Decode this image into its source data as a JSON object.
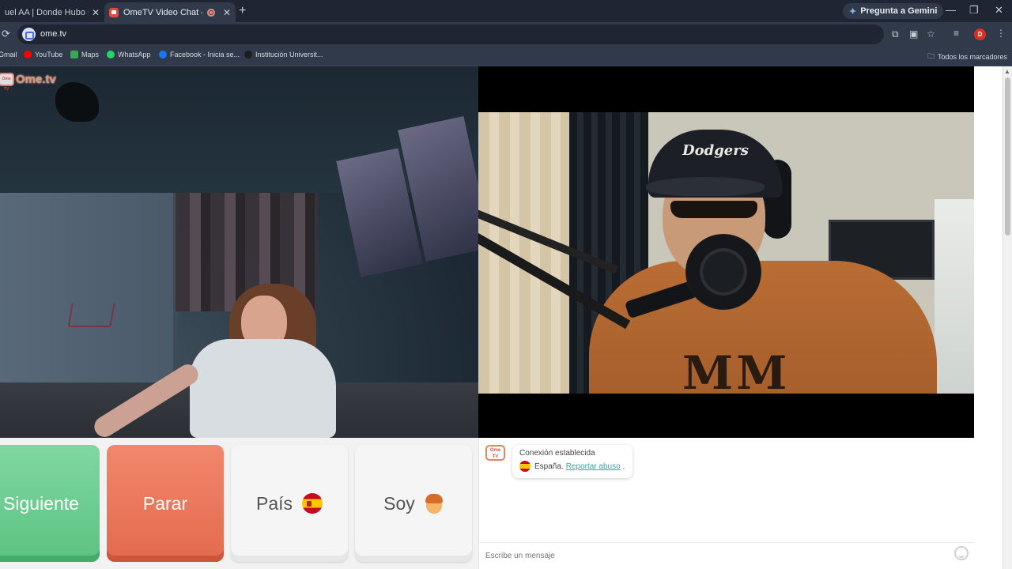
{
  "browser": {
    "tabs": [
      {
        "title": "uel AA | Donde Hubo Fuego",
        "close": "✕"
      },
      {
        "title": "OmeTV Video Chat — Ome",
        "close": "✕",
        "recording": true
      }
    ],
    "new_tab": "+",
    "gemini_label": "Pregunta a Gemini",
    "window_controls": {
      "minimize": "—",
      "restore": "❐",
      "close": "✕"
    },
    "url": "ome.tv",
    "profile_initial": "D",
    "bookmarks": [
      {
        "label": "Gmail",
        "icon": "gmail-icon",
        "color": "#ea4335"
      },
      {
        "label": "YouTube",
        "icon": "youtube-icon",
        "color": "#ff0000"
      },
      {
        "label": "Maps",
        "icon": "maps-icon",
        "color": "#34a853"
      },
      {
        "label": "WhatsApp",
        "icon": "whatsapp-icon",
        "color": "#25d366"
      },
      {
        "label": "Facebook - Inicia se...",
        "icon": "facebook-icon",
        "color": "#1877f2"
      },
      {
        "label": "Institución Universit...",
        "icon": "institution-icon",
        "color": "#1d1d1d"
      }
    ],
    "all_bookmarks_label": "Todos los marcadores"
  },
  "page": {
    "logo_tv": "Ome TV",
    "logo_word": "Ome.tv",
    "camera_right": {
      "cap_text": "Dodgers",
      "shirt_print": "MM"
    },
    "controls": {
      "next_label": "Siguiente",
      "stop_label": "Parar",
      "country_label": "País",
      "country_flag": "spain-flag-icon",
      "gender_label": "Soy",
      "gender_icon": "boy-emoji-icon"
    },
    "chat": {
      "logo_tv": "Ome TV",
      "connection_text": "Conexión establecida",
      "country_text": "España.",
      "report_link": "Reportar abuso",
      "report_suffix": ".",
      "input_placeholder": "Escribe un mensaje"
    },
    "colors": {
      "next_green": "#5cc282",
      "stop_red": "#e36a4e",
      "brand_orange": "#ef8a6a",
      "link_teal": "#3aa4a0"
    }
  }
}
